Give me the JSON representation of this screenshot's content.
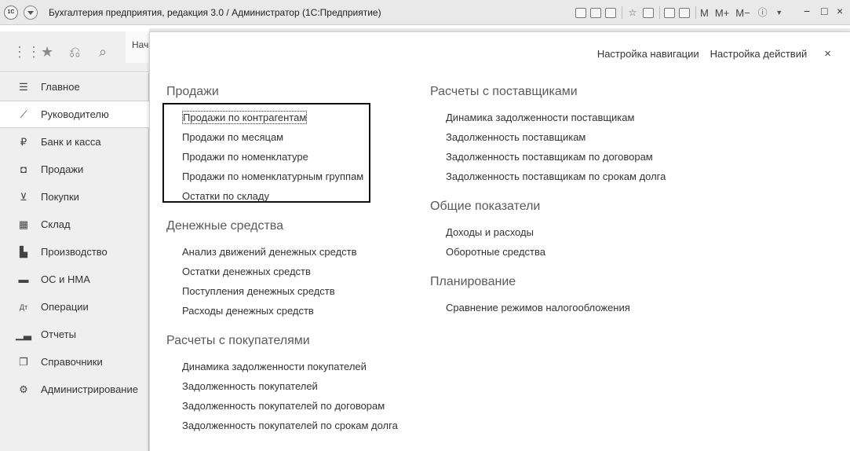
{
  "titlebar": {
    "logo": "1С",
    "title": "Бухгалтерия предприятия, редакция 3.0 / Администратор  (1С:Предприятие)",
    "tools": [
      "M",
      "M+",
      "M−"
    ],
    "icons": [
      "save-icon",
      "print-icon",
      "preview-icon",
      "favorites-icon",
      "bookmark-icon",
      "calculator-icon",
      "calendar-icon",
      "info-icon"
    ],
    "window_controls": [
      "−",
      "□",
      "×"
    ]
  },
  "background_tab": {
    "label": "Нач"
  },
  "sidebar": {
    "items": [
      {
        "label": "Главное",
        "icon": "menu-lines-icon"
      },
      {
        "label": "Руководителю",
        "icon": "trend-icon"
      },
      {
        "label": "Банк и касса",
        "icon": "ruble-icon"
      },
      {
        "label": "Продажи",
        "icon": "bag-icon"
      },
      {
        "label": "Покупки",
        "icon": "cart-icon"
      },
      {
        "label": "Склад",
        "icon": "warehouse-icon"
      },
      {
        "label": "Производство",
        "icon": "factory-icon"
      },
      {
        "label": "ОС и НМА",
        "icon": "truck-icon"
      },
      {
        "label": "Операции",
        "icon": "dt-kt-icon"
      },
      {
        "label": "Отчеты",
        "icon": "report-chart-icon"
      },
      {
        "label": "Справочники",
        "icon": "reference-books-icon"
      },
      {
        "label": "Администрирование",
        "icon": "gear-icon"
      }
    ]
  },
  "panel": {
    "actions": {
      "nav_settings": "Настройка навигации",
      "action_settings": "Настройка действий",
      "close": "×"
    },
    "left_groups": [
      {
        "title": "Продажи",
        "links": [
          "Продажи по контрагентам",
          "Продажи по месяцам",
          "Продажи по номенклатуре",
          "Продажи по номенклатурным группам",
          "Остатки по складу"
        ]
      },
      {
        "title": "Денежные средства",
        "links": [
          "Анализ движений денежных средств",
          "Остатки денежных средств",
          "Поступления денежных средств",
          "Расходы денежных средств"
        ]
      },
      {
        "title": "Расчеты с покупателями",
        "links": [
          "Динамика задолженности покупателей",
          "Задолженность покупателей",
          "Задолженность покупателей по договорам",
          "Задолженность покупателей по срокам долга"
        ]
      }
    ],
    "right_groups": [
      {
        "title": "Расчеты с поставщиками",
        "links": [
          "Динамика задолженности поставщикам",
          "Задолженность поставщикам",
          "Задолженность поставщикам по договорам",
          "Задолженность поставщикам по срокам долга"
        ]
      },
      {
        "title": "Общие показатели",
        "links": [
          "Доходы и расходы",
          "Оборотные средства"
        ]
      },
      {
        "title": "Планирование",
        "links": [
          "Сравнение режимов налогообложения"
        ]
      }
    ]
  }
}
